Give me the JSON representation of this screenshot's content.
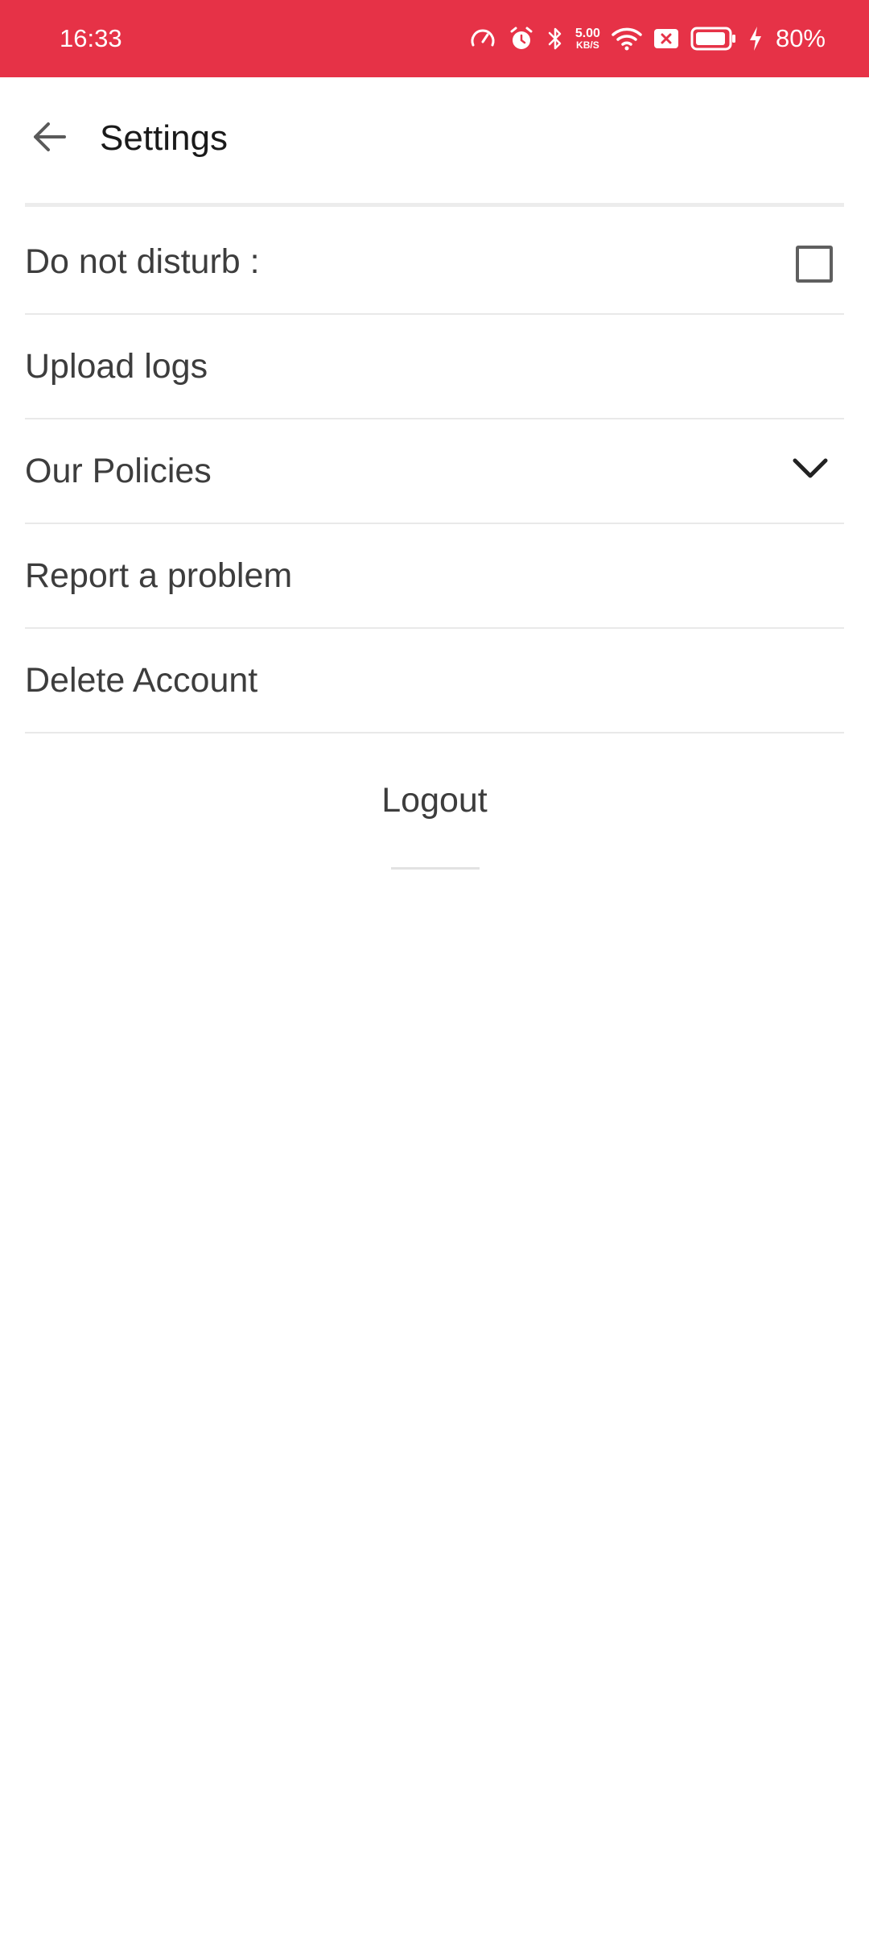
{
  "status_bar": {
    "time": "16:33",
    "net_speed_value": "5.00",
    "net_speed_unit": "KB/S",
    "battery_percent": "80%",
    "background_color": "#e63247",
    "icons": [
      "speedometer-icon",
      "alarm-icon",
      "bluetooth-icon",
      "wifi-icon",
      "notification-blocked-icon",
      "battery-icon",
      "charging-icon"
    ]
  },
  "header": {
    "title": "Settings",
    "back_icon": "arrow-left-icon"
  },
  "menu": {
    "items": [
      {
        "label": "Do not disturb :",
        "control": "checkbox",
        "checked": false
      },
      {
        "label": "Upload logs"
      },
      {
        "label": "Our Policies",
        "control": "chevron-down-icon",
        "expanded": false
      },
      {
        "label": "Report a problem"
      },
      {
        "label": "Delete Account"
      }
    ]
  },
  "logout": {
    "label": "Logout"
  }
}
